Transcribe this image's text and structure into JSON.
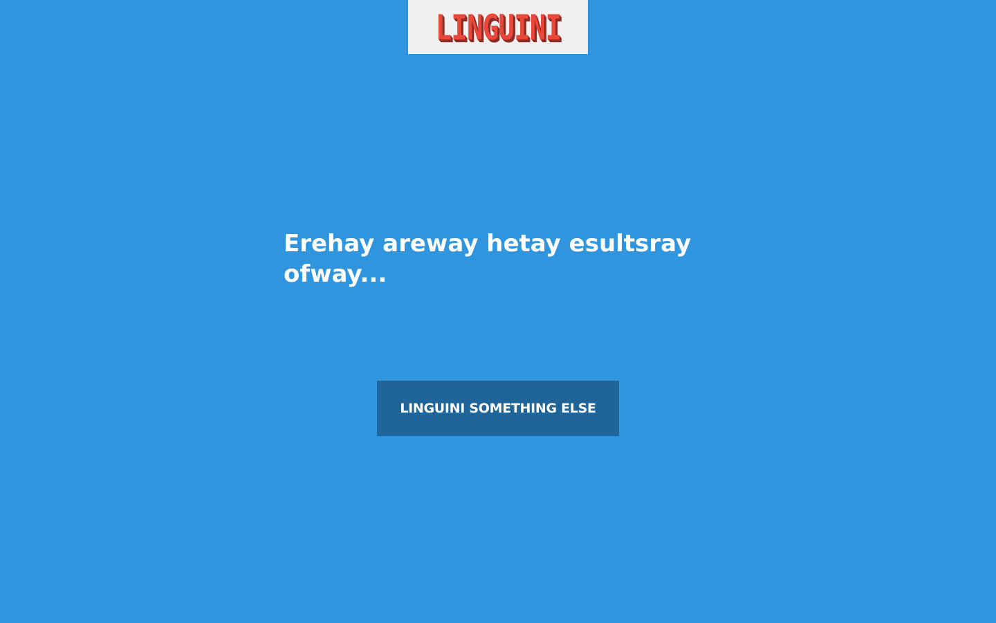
{
  "header": {
    "logo_text": "LINGUINI",
    "logo_color": "#e8473a",
    "logo_background": "#f0f0f0"
  },
  "main": {
    "heading": "Erehay areway hetay esultsray ofway...",
    "button_label": "LINGUINI SOMETHING ELSE"
  },
  "colors": {
    "page_background": "#2e95de",
    "button_background": "#1f6599",
    "text": "#ffffff"
  }
}
